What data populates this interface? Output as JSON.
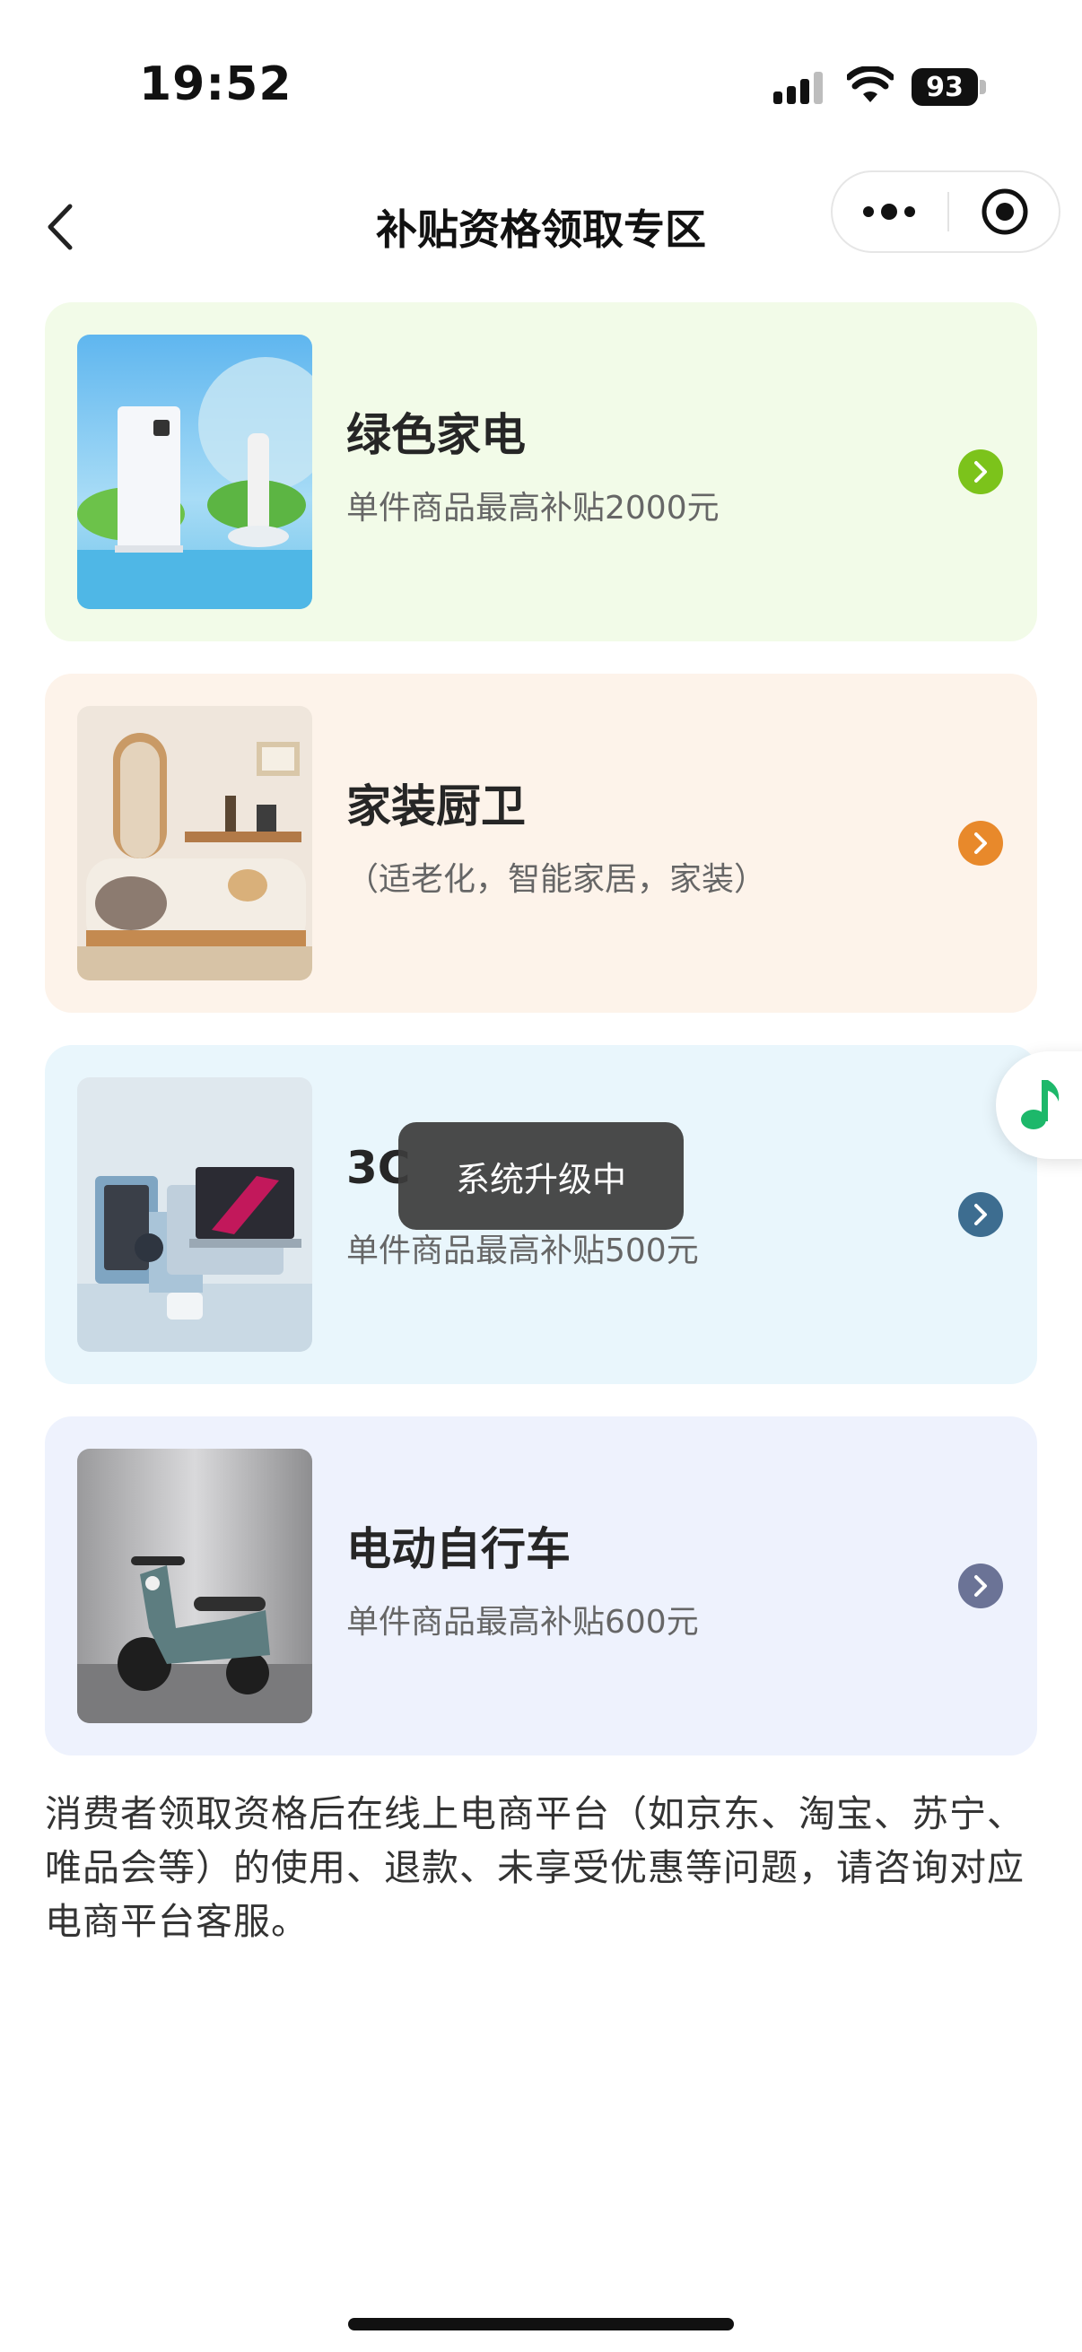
{
  "status_bar": {
    "time": "19:52",
    "battery": "93",
    "icons": [
      "cellular-signal-icon",
      "wifi-icon",
      "battery-icon"
    ]
  },
  "nav": {
    "title": "补贴资格领取专区",
    "back_icon": "chevron-left-icon",
    "more_icon": "more-dots-icon",
    "close_icon": "target-close-icon"
  },
  "cards": [
    {
      "title": "绿色家电",
      "subtitle": "单件商品最高补贴2000元",
      "bg_color": "#f2fbe8",
      "arrow_color": "#7cc31b",
      "image": "green-appliances-image"
    },
    {
      "title": "家装厨卫",
      "subtitle": "（适老化，智能家居，家装）",
      "bg_color": "#fdf3ea",
      "arrow_color": "#e8892b",
      "image": "home-decor-sofa-image"
    },
    {
      "title": "3C",
      "subtitle": "单件商品最高补贴500元",
      "bg_color": "#e9f6fc",
      "arrow_color": "#3d6d90",
      "image": "digital-devices-image"
    },
    {
      "title": "电动自行车",
      "subtitle": "单件商品最高补贴600元",
      "bg_color": "#eef2fd",
      "arrow_color": "#6b7396",
      "image": "electric-scooter-image"
    }
  ],
  "toast": {
    "text": "系统升级中"
  },
  "floating_button": {
    "icon": "music-note-icon",
    "color": "#1db86a"
  },
  "footnote": "消费者领取资格后在线上电商平台（如京东、淘宝、苏宁、唯品会等）的使用、退款、未享受优惠等问题，请咨询对应电商平台客服。"
}
